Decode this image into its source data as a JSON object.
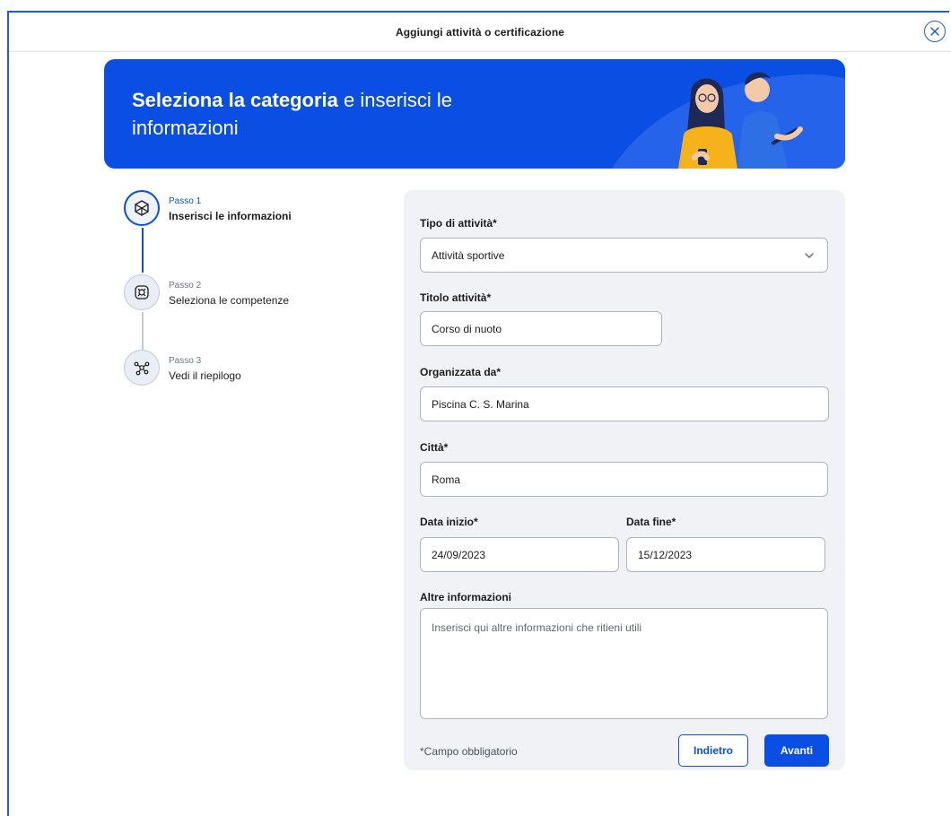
{
  "modal": {
    "title": "Aggiungi attività o certificazione",
    "close_icon": "close-circle-icon"
  },
  "banner": {
    "title_bold": "Seleziona la categoria",
    "title_rest": " e inserisci le informazioni",
    "background_color": "#0a4ee4"
  },
  "steps": [
    {
      "kicker": "Passo 1",
      "label": "Inserisci le informazioni",
      "state": "active",
      "icon": "cube-icon"
    },
    {
      "kicker": "Passo 2",
      "label": "Seleziona le competenze",
      "state": "upcoming",
      "icon": "skills-icon"
    },
    {
      "kicker": "Passo 3",
      "label": "Vedi il riepilogo",
      "state": "upcoming",
      "icon": "network-icon"
    }
  ],
  "form": {
    "tipo": {
      "label": "Tipo di attività*",
      "value": "Attività sportive"
    },
    "titolo": {
      "label": "Titolo attività*",
      "value": "Corso di nuoto"
    },
    "organizzata": {
      "label": "Organizzata da*",
      "value": "Piscina C. S. Marina"
    },
    "citta": {
      "label": "Città*",
      "value": "Roma"
    },
    "data_inizio": {
      "label": "Data inizio*",
      "value": "24/09/2023"
    },
    "data_fine": {
      "label": "Data fine*",
      "value": "15/12/2023"
    },
    "altre": {
      "label": "Altre informazioni",
      "placeholder": "Inserisci qui altre informazioni che ritieni utili"
    },
    "required_note": "*Campo obbligatorio",
    "back_label": "Indietro",
    "next_label": "Avanti"
  },
  "colors": {
    "accent": "#0a4ee4",
    "card": "#f1f2f5"
  }
}
